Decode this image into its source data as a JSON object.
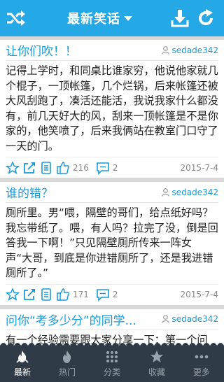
{
  "header": {
    "title": "最新笑话"
  },
  "posts": [
    {
      "title": "让你们吹！！",
      "author": "sedade342",
      "body": "记得上学时，和同桌比谁家穷，他说他家就几个棍子，一顶帐篷，几个烂锅，后来帐篷还被大风刮跑了，凑活还能活，我说我家什么都没有，前几天好大的风，刮来一顶帐篷是不是你家的，他笑喷了，后来我俩站在教室门口守了一天的门。",
      "likes": "216",
      "comments": "2",
      "date": "2015-7-4"
    },
    {
      "title": "谁的错？",
      "author": "sedade342",
      "body": "厕所里。男“喂，隔壁的哥们，给点纸好吗？我忘带纸了。喂，有人吗？拉完了没，倒是回答我一下啊！”只见隔壁厕所传来一阵女声“大哥，到底是你进错厕所了，还是我进错厕所了。”",
      "likes": "171",
      "comments": "2",
      "date": "2015-7-4"
    },
    {
      "title": "问你“考多少分”的同学...",
      "author": "sedade342",
      "body": "有一个经验需要跟大家分享一下：第一个问你“考多少分”的同学，不是真正关",
      "likes": "",
      "comments": "",
      "date": ""
    }
  ],
  "tabs": [
    {
      "label": "最新",
      "icon": "flame-icon"
    },
    {
      "label": "热门",
      "icon": "fire-icon"
    },
    {
      "label": "分类",
      "icon": "grid-icon"
    },
    {
      "label": "收藏",
      "icon": "star-icon"
    },
    {
      "label": "更多",
      "icon": "more-icon"
    }
  ],
  "colors": {
    "header": "#25a9e6",
    "accent": "#1a9bd8",
    "bottom_bar": "#2f3b46"
  }
}
